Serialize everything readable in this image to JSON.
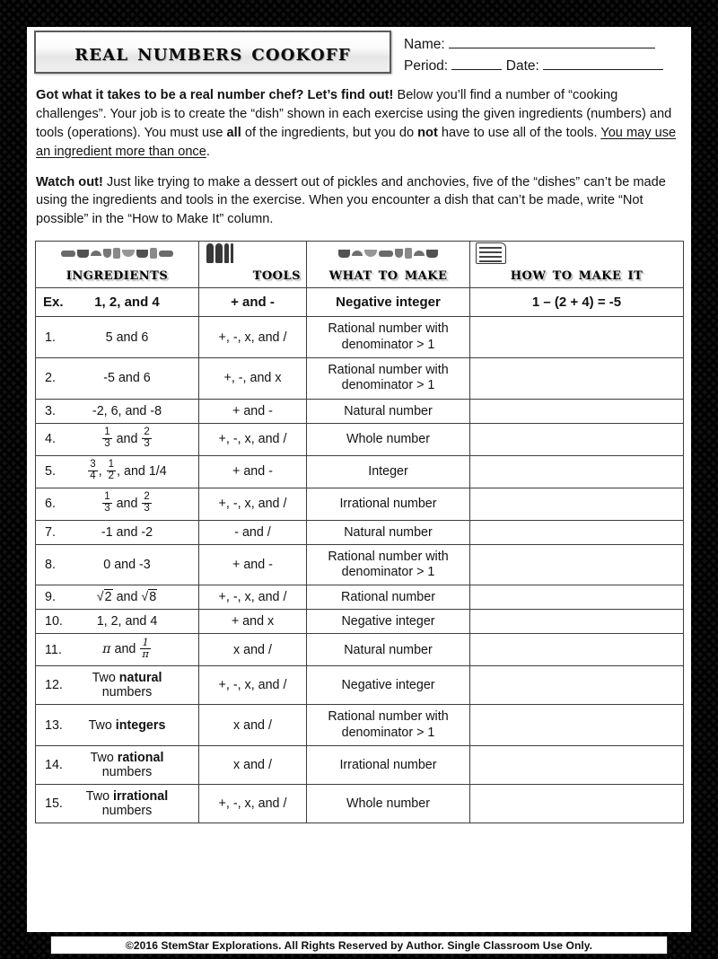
{
  "title": "REAL NUMBERS COOKOFF",
  "header_fields": {
    "name_label": "Name:",
    "period_label": "Period:",
    "date_label": "Date:"
  },
  "instructions": {
    "para1_bold": "Got what it takes to be a real number chef?  Let’s find out!",
    "para1_a": "  Below you’ll find a number of “cooking challenges”.   Your job is to create the “dish” shown in each exercise using the given ingredients (numbers) and tools (operations). You must use ",
    "para1_bold2": "all",
    "para1_b": " of the ingredients, but you do ",
    "para1_bold3": "not",
    "para1_c": " have to use all of the tools. ",
    "para1_underline": "You may use an ingredient more than once",
    "para1_d": ".",
    "para2_bold": "Watch out!",
    "para2_a": " Just like trying to make a dessert out of pickles and anchovies, five of the “dishes” can’t be made using the ingredients and tools in the exercise.   When you encounter a dish that can’t be made, write “Not possible” in the “How to Make It” column."
  },
  "table": {
    "headers": {
      "ingredients": "INGREDIENTS",
      "tools": "TOOLS",
      "what_to_make": "WHAT TO MAKE",
      "how_to_make_it": "HOW TO MAKE IT"
    },
    "header_icons": {
      "ingredients": "kitchen-ingredients-clipart",
      "tools": "cooking-utensils-clipart",
      "what_to_make": "cookware-clipart",
      "how_to_make_it": "recipe-card-clipart"
    },
    "example_row": {
      "number": "Ex.",
      "ingredients": "1, 2, and 4",
      "tools": "+ and -",
      "what_to_make": "Negative integer",
      "how_to_make_it": "1 – (2 + 4) = -5"
    },
    "rows": [
      {
        "number": "1.",
        "ingredients_plain": "5 and 6",
        "tools": "+, -, x, and /",
        "what_line1": "Rational number with",
        "what_line2": "denominator > 1",
        "answer": ""
      },
      {
        "number": "2.",
        "ingredients_plain": "-5 and 6",
        "tools": "+, -, and x",
        "what_line1": "Rational number with",
        "what_line2": "denominator > 1",
        "answer": ""
      },
      {
        "number": "3.",
        "ingredients_plain": "-2, 6, and -8",
        "tools": "+ and -",
        "what_line1": "Natural number",
        "what_line2": "",
        "answer": ""
      },
      {
        "number": "4.",
        "ingredients_frac": "1/3 and 2/3",
        "tools": "+, -, x, and /",
        "what_line1": "Whole number",
        "what_line2": "",
        "answer": ""
      },
      {
        "number": "5.",
        "ingredients_frac": "3/4, 1/2, and 1/4",
        "tools": "+ and -",
        "what_line1": "Integer",
        "what_line2": "",
        "answer": ""
      },
      {
        "number": "6.",
        "ingredients_frac": "1/3 and 2/3",
        "tools": "+, -, x, and /",
        "what_line1": "Irrational number",
        "what_line2": "",
        "answer": ""
      },
      {
        "number": "7.",
        "ingredients_plain": "-1 and -2",
        "tools": "- and /",
        "what_line1": "Natural number",
        "what_line2": "",
        "answer": ""
      },
      {
        "number": "8.",
        "ingredients_plain": "0 and -3",
        "tools": "+ and -",
        "what_line1": "Rational number with",
        "what_line2": "denominator > 1",
        "answer": ""
      },
      {
        "number": "9.",
        "ingredients_rad": "√2 and √8",
        "tools": "+, -, x, and /",
        "what_line1": "Rational number",
        "what_line2": "",
        "answer": ""
      },
      {
        "number": "10.",
        "ingredients_plain": "1, 2, and 4",
        "tools": "+ and x",
        "what_line1": "Negative integer",
        "what_line2": "",
        "answer": ""
      },
      {
        "number": "11.",
        "ingredients_pi": "π and 1/π",
        "tools": "x and /",
        "what_line1": "Natural number",
        "what_line2": "",
        "answer": ""
      },
      {
        "number": "12.",
        "ing_pre": "Two ",
        "ing_bold": "natural",
        "ing_post": "numbers",
        "tools": "+, -, x, and /",
        "what_line1": "Negative integer",
        "what_line2": "",
        "answer": ""
      },
      {
        "number": "13.",
        "ing_pre": "Two ",
        "ing_bold": "integers",
        "ing_post": "",
        "tools": "x and /",
        "what_line1": "Rational number with",
        "what_line2": "denominator > 1",
        "answer": ""
      },
      {
        "number": "14.",
        "ing_pre": "Two ",
        "ing_bold": "rational",
        "ing_post": "numbers",
        "tools": "x and /",
        "what_line1": "Irrational number",
        "what_line2": "",
        "answer": ""
      },
      {
        "number": "15.",
        "ing_pre": "Two ",
        "ing_bold": "irrational",
        "ing_post": "numbers",
        "tools": "+, -, x, and /",
        "what_line1": "Whole number",
        "what_line2": "",
        "answer": ""
      }
    ]
  },
  "footer": "©2016 StemStar Explorations. All Rights Reserved by Author.  Single Classroom Use Only.",
  "colors": {
    "ink": "#121212",
    "rule": "#3d3d3d",
    "border_dark": "#111111",
    "border_light": "#ffffff",
    "plaque_border": "#5a5a5a"
  }
}
